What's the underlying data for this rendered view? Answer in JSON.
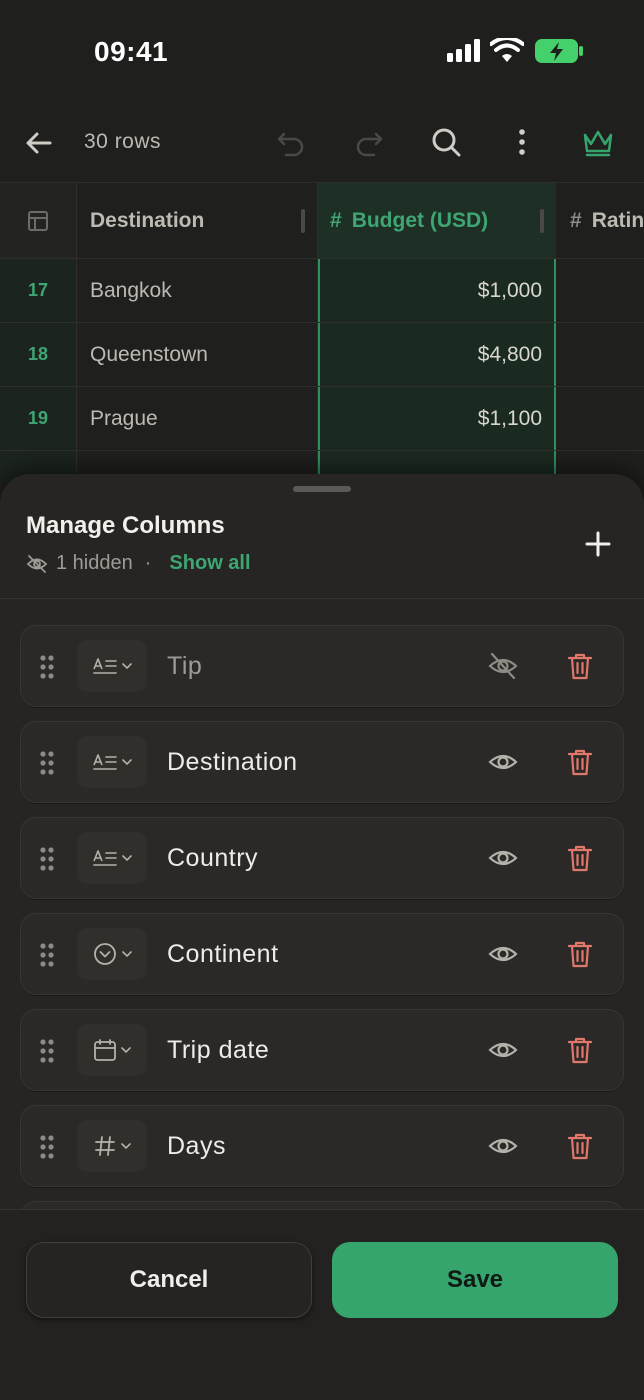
{
  "status_bar": {
    "time": "09:41"
  },
  "toolbar": {
    "title": "30 rows"
  },
  "grid": {
    "headers": {
      "destination": "Destination",
      "budget": "Budget (USD)",
      "budget_prefix": "#",
      "rating_prefix": "#",
      "rating": "Rating"
    },
    "rows": [
      {
        "num": "17",
        "destination": "Bangkok",
        "budget": "$1,000"
      },
      {
        "num": "18",
        "destination": "Queenstown",
        "budget": "$4,800"
      },
      {
        "num": "19",
        "destination": "Prague",
        "budget": "$1,100"
      }
    ]
  },
  "sheet": {
    "title": "Manage Columns",
    "hidden_count": "1 hidden",
    "separator": "·",
    "show_all": "Show all",
    "columns": [
      {
        "label": "Tip",
        "type_icon": "text-type-icon",
        "visible": false
      },
      {
        "label": "Destination",
        "type_icon": "text-type-icon",
        "visible": true
      },
      {
        "label": "Country",
        "type_icon": "text-type-icon",
        "visible": true
      },
      {
        "label": "Continent",
        "type_icon": "select-type-icon",
        "visible": true
      },
      {
        "label": "Trip date",
        "type_icon": "date-type-icon",
        "visible": true
      },
      {
        "label": "Days",
        "type_icon": "number-type-icon",
        "visible": true
      }
    ]
  },
  "footer": {
    "cancel": "Cancel",
    "save": "Save"
  },
  "colors": {
    "accent": "#35a56d",
    "danger": "#e0776a",
    "background": "#1f1f1d"
  }
}
